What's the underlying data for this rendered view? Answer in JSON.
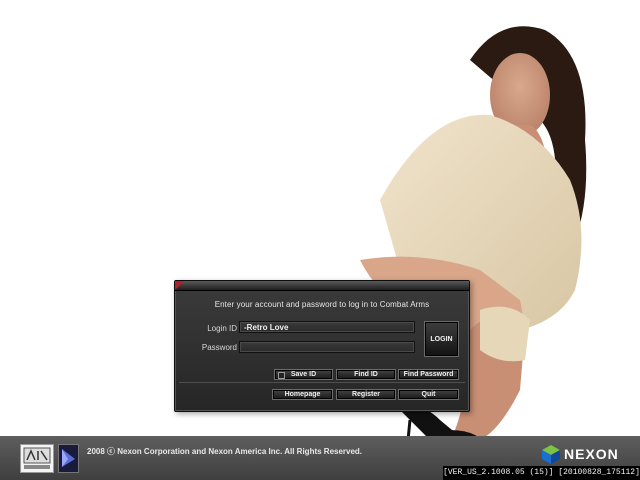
{
  "login": {
    "prompt": "Enter your account and password to log in to Combat Arms",
    "login_id_label": "Login ID",
    "password_label": "Password",
    "login_id_value": "-Retro Love",
    "password_value": "",
    "login_button": "LOGIN",
    "save_id_label": "Save ID",
    "find_id_label": "Find ID",
    "find_password_label": "Find Password",
    "homepage_label": "Homepage",
    "register_label": "Register",
    "quit_label": "Quit"
  },
  "footer": {
    "copyright": "2008 ⓒ Nexon Corporation and Nexon America Inc.  All Rights Reserved.",
    "brand": "NEXON",
    "version": "[VER_US_2.1008.05 (15)]  [20100828_175112]"
  },
  "colors": {
    "panel_bg": "#2e2e2e",
    "accent_red": "#b3202a",
    "footer_bg": "#4f4f4f",
    "nexon_blue": "#1b6fd1",
    "nexon_green": "#7dc242"
  }
}
